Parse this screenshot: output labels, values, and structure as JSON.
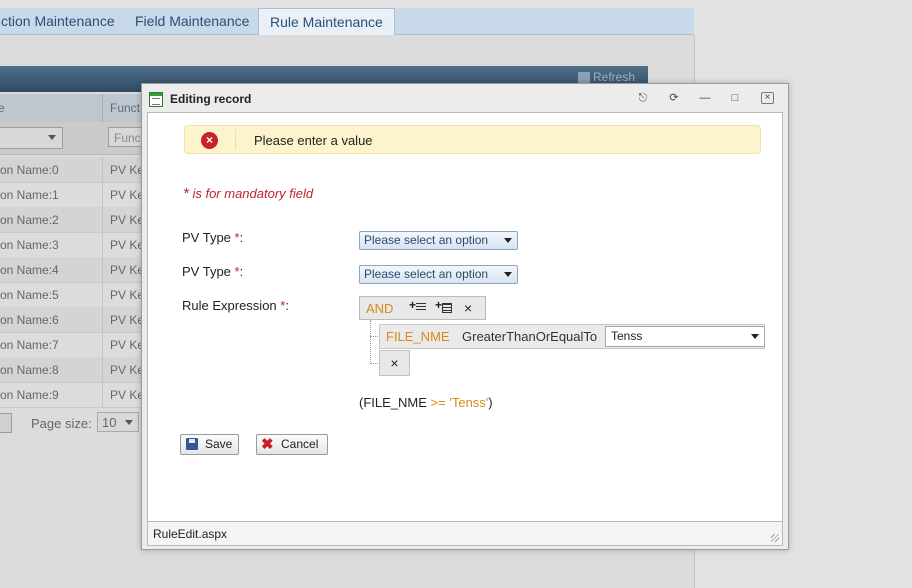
{
  "background": {
    "tabs": [
      "ction Maintenance",
      "Field Maintenance",
      "Rule Maintenance"
    ],
    "refresh_label": "Refresh",
    "column_headers": [
      "e",
      "Funct"
    ],
    "filter_placeholder": "Func",
    "rows": [
      {
        "name": "on Name:0",
        "func": "PV Ke"
      },
      {
        "name": "on Name:1",
        "func": "PV Ke"
      },
      {
        "name": "on Name:2",
        "func": "PV Ke"
      },
      {
        "name": "on Name:3",
        "func": "PV Ke"
      },
      {
        "name": "on Name:4",
        "func": "PV Ke"
      },
      {
        "name": "on Name:5",
        "func": "PV Ke"
      },
      {
        "name": "on Name:6",
        "func": "PV Ke"
      },
      {
        "name": "on Name:7",
        "func": "PV Ke"
      },
      {
        "name": "on Name:8",
        "func": "PV Ke"
      },
      {
        "name": "on Name:9",
        "func": "PV Ke"
      }
    ],
    "pager": {
      "page_size_label": "Page size:",
      "page_size_value": "10"
    }
  },
  "dialog": {
    "title": "Editing record",
    "alert_text": "Please enter a value",
    "mandatory_star": "*",
    "mandatory_note": "is for mandatory field",
    "fields": [
      {
        "label": "PV Type",
        "required_mark": "*",
        "colon": ":",
        "value": "Please select an option"
      },
      {
        "label": "PV Type",
        "required_mark": "*",
        "colon": ":",
        "value": "Please select an option"
      }
    ],
    "rule_expression": {
      "label": "Rule Expression",
      "required_mark": "*",
      "colon": ":",
      "group_operator": "AND",
      "condition": {
        "field": "FILE_NME",
        "operator": "GreaterThanOrEqualTo",
        "value": "Tenss"
      },
      "preview": {
        "open": "(",
        "field": "FILE_NME",
        "op": ">=",
        "value": "'Tenss'",
        "close": ")"
      }
    },
    "buttons": {
      "save": "Save",
      "cancel": "Cancel"
    },
    "status_text": "RuleEdit.aspx"
  },
  "colors": {
    "accent_orange": "#d98a1b",
    "required_red": "#c0222a",
    "alert_bg": "#fdf3cd",
    "error_icon": "#c8212b"
  },
  "icons": [
    "pin-icon",
    "reload-icon",
    "minimize-icon",
    "maximize-icon",
    "close-icon",
    "error-icon",
    "add-condition-icon",
    "add-group-icon",
    "delete-icon",
    "save-icon",
    "cancel-icon"
  ]
}
